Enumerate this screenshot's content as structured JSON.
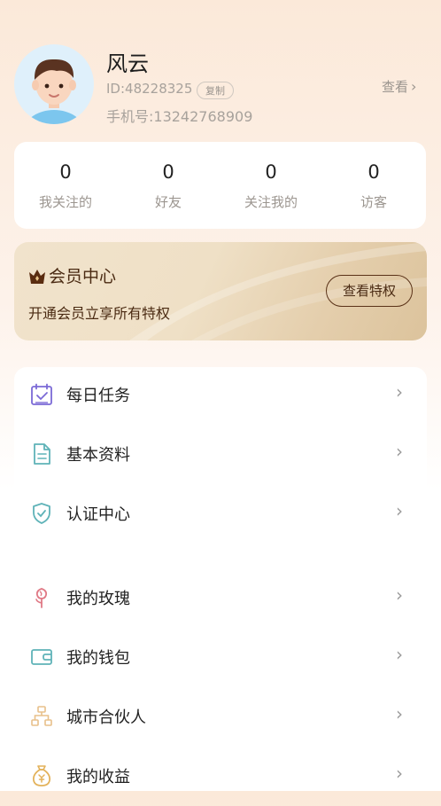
{
  "profile": {
    "name": "风云",
    "id": "ID:48228325",
    "copy_label": "复制",
    "phone": "手机号:13242768909",
    "view_label": "查看"
  },
  "stats": [
    {
      "value": "0",
      "label": "我关注的"
    },
    {
      "value": "0",
      "label": "好友"
    },
    {
      "value": "0",
      "label": "关注我的"
    },
    {
      "value": "0",
      "label": "访客"
    }
  ],
  "vip": {
    "title": "会员中心",
    "subtitle": "开通会员立享所有特权",
    "button": "查看特权"
  },
  "menu": [
    {
      "label": "每日任务",
      "icon": "calendar-check-icon"
    },
    {
      "label": "基本资料",
      "icon": "document-icon"
    },
    {
      "label": "认证中心",
      "icon": "shield-check-icon"
    },
    {
      "label": "我的玫瑰",
      "icon": "rose-icon"
    },
    {
      "label": "我的钱包",
      "icon": "wallet-icon"
    },
    {
      "label": "城市合伙人",
      "icon": "partner-network-icon"
    },
    {
      "label": "我的收益",
      "icon": "money-bag-icon"
    }
  ],
  "colors": {
    "accent_purple": "#7b6ad6",
    "accent_teal": "#5fb3b8",
    "rose": "#e07a86",
    "gold": "#e3b25a",
    "vip_text": "#4a2a12"
  }
}
